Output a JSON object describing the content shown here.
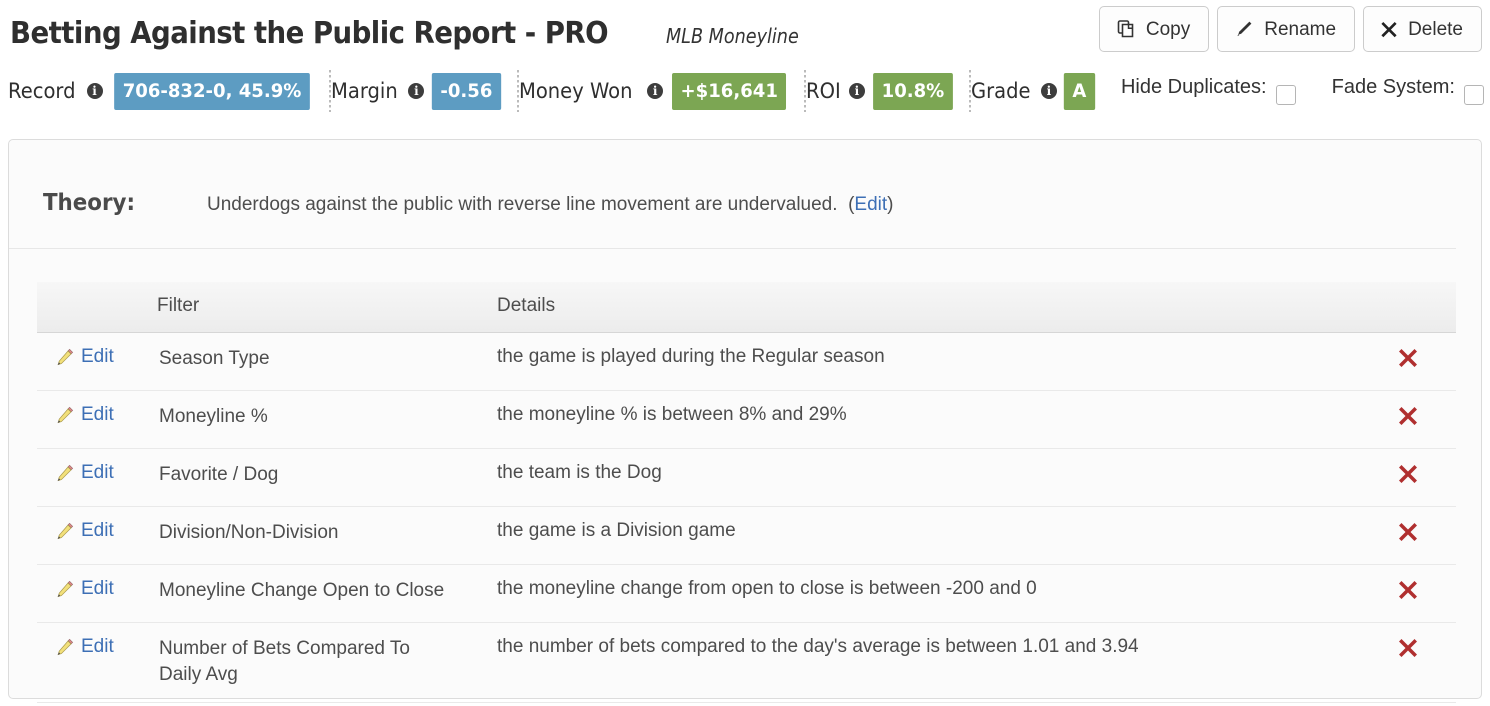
{
  "header": {
    "title": "Betting Against the Public Report - PRO",
    "subtitle": "MLB Moneyline",
    "actions": [
      {
        "label": "Copy",
        "icon": "copy-icon"
      },
      {
        "label": "Rename",
        "icon": "pencil-icon"
      },
      {
        "label": "Delete",
        "icon": "x-icon"
      }
    ]
  },
  "stats": {
    "items": [
      {
        "label": "Record",
        "value": "706-832-0, 45.9%",
        "color": "#5d9cc2",
        "style": "blue"
      },
      {
        "label": "Margin",
        "value": "-0.56",
        "color": "#5d9cc2",
        "style": "blue"
      },
      {
        "label": "Money Won",
        "value": "+$16,641",
        "color": "#7ca653",
        "style": "green"
      },
      {
        "label": "ROI",
        "value": "10.8%",
        "color": "#7ca653",
        "style": "green"
      },
      {
        "label": "Grade",
        "value": "A",
        "color": "#7ca653",
        "style": "green"
      }
    ],
    "info_glyph": "i"
  },
  "toggles": [
    {
      "label": "Hide Duplicates:",
      "checked": false
    },
    {
      "label": "Fade System:",
      "checked": false
    }
  ],
  "theory": {
    "label": "Theory:",
    "text": "Underdogs against the public with reverse line movement are undervalued.",
    "edit_open": "(",
    "edit_label": "Edit",
    "edit_close": ")"
  },
  "table": {
    "columns": [
      "",
      "Filter",
      "Details",
      ""
    ],
    "edit_label": "Edit",
    "rows": [
      {
        "filter": "Season Type",
        "details": "the game is played during the Regular season"
      },
      {
        "filter": "Moneyline %",
        "details": "the moneyline % is between 8% and 29%"
      },
      {
        "filter": "Favorite / Dog",
        "details": "the team is the Dog"
      },
      {
        "filter": "Division/Non-Division",
        "details": "the game is a Division game"
      },
      {
        "filter": "Moneyline Change Open to Close",
        "details": "the moneyline change from open to close is between -200 and 0"
      },
      {
        "filter": "Number of Bets Compared To Daily Avg",
        "details": "the number of bets compared to the day's average is between 1.01 and 3.94"
      }
    ]
  },
  "colors": {
    "link": "#3d6fb5",
    "delete_x": "#b02f2f",
    "blue_badge": "#5d9cc2",
    "green_badge": "#7ca653",
    "panel_border": "#dcdcdc"
  }
}
